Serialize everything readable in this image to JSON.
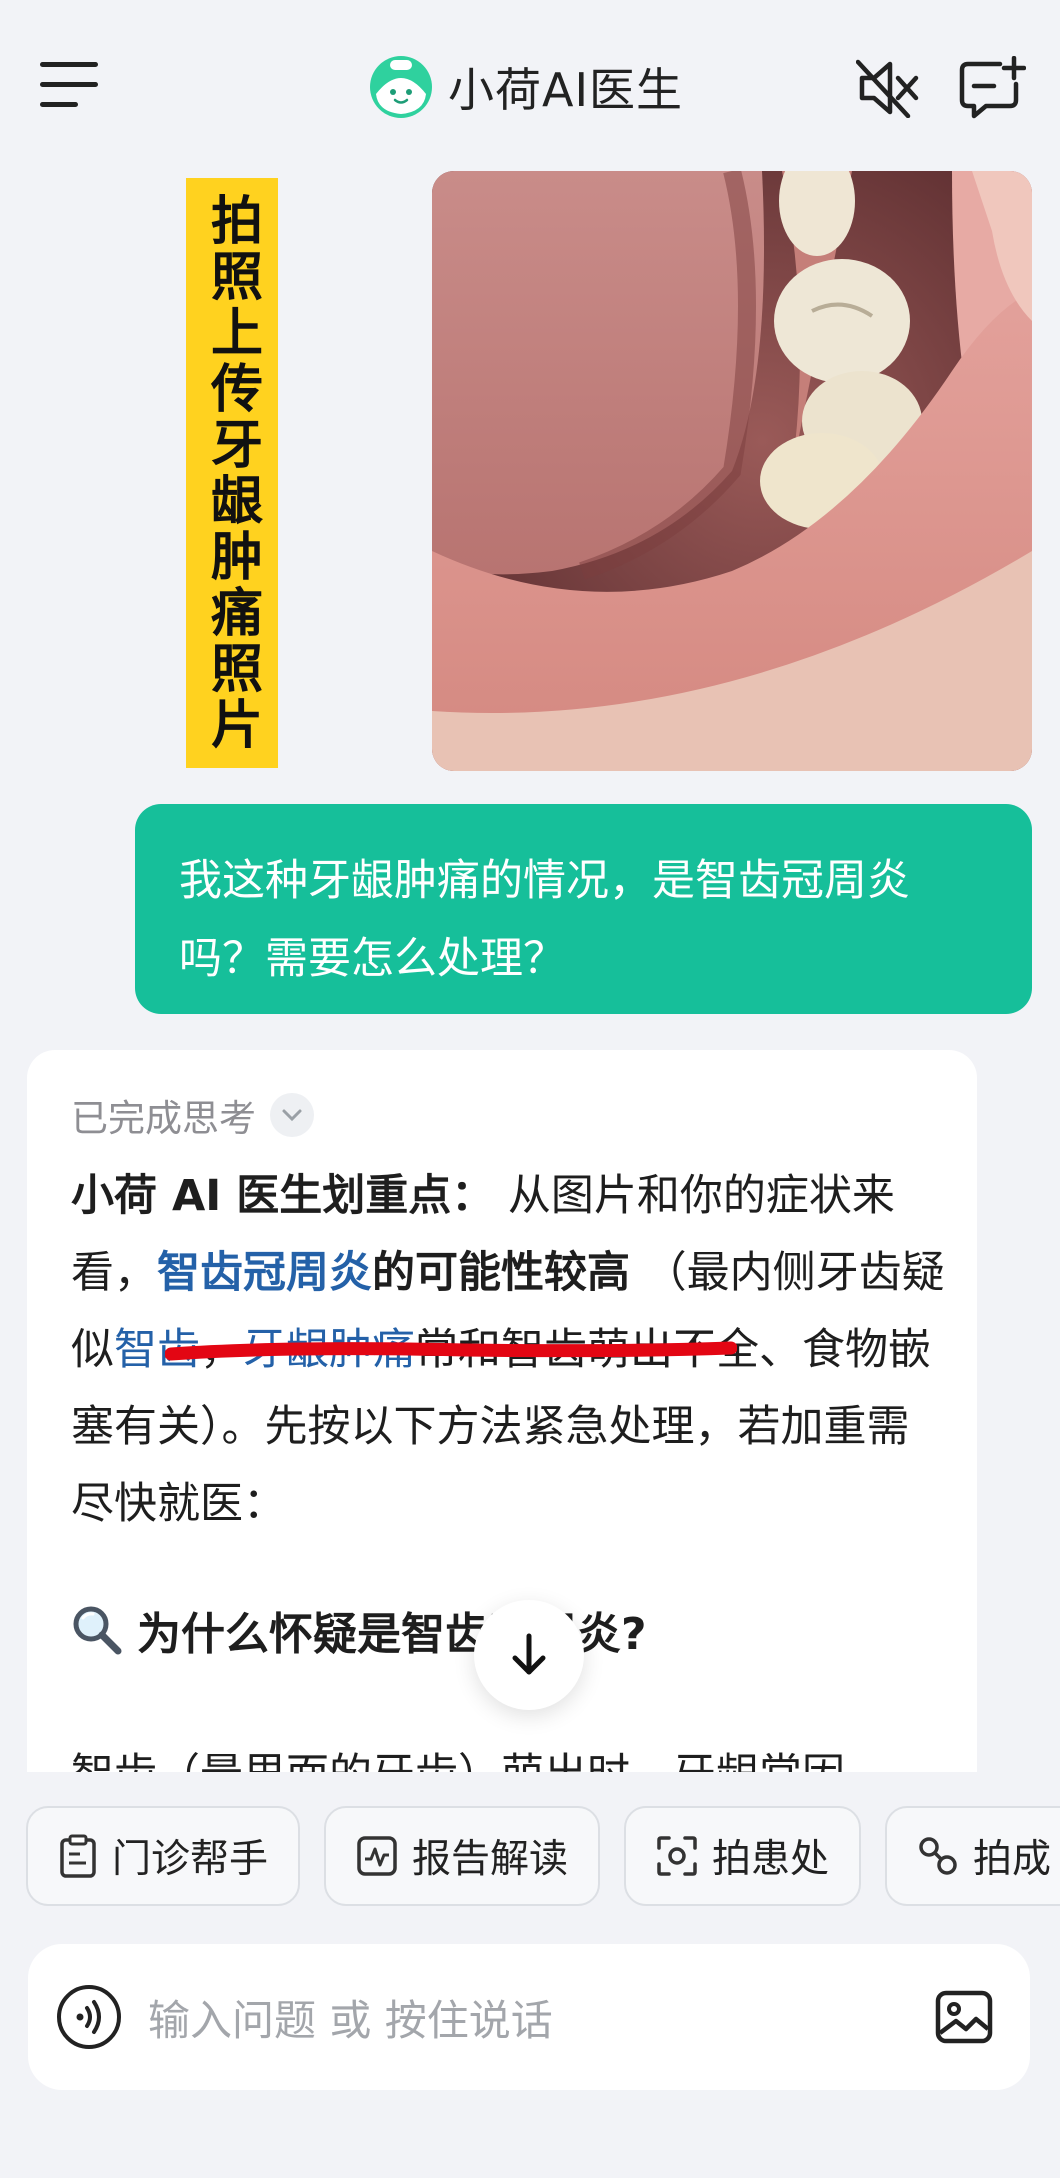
{
  "header": {
    "title": "小荷AI医生",
    "icons": [
      "menu-icon",
      "logo-icon",
      "mute-icon",
      "new-chat-icon"
    ]
  },
  "user_photo_banner": "拍照上传牙龈肿痛照片",
  "user_message": "我这种牙龈肿痛的情况，是智齿冠周炎吗？需要怎么处理？",
  "ai": {
    "thinking_label": "已完成思考",
    "answer": {
      "lead": "小荷 AI 医生划重点：",
      "t1": " 从图片和你的症状来看，",
      "diag_link": "智齿冠周炎",
      "diag_rest": "的可能性较高",
      "t2": " （最内侧牙齿疑似",
      "link2": "智齿",
      "t3": "，",
      "link3": "牙龈肿痛",
      "t4": "常和智齿萌出不全、食物嵌塞有关）。先按以下方法紧急处理，若加重需尽快就医："
    },
    "section_heading": "为什么怀疑是智齿冠周炎?",
    "cut_text": "智齿（最里面的牙齿）萌出时，牙龈常因"
  },
  "chips": [
    {
      "label": "门诊帮手",
      "icon": "clipboard-icon"
    },
    {
      "label": "报告解读",
      "icon": "report-icon"
    },
    {
      "label": "拍患处",
      "icon": "scan-icon"
    },
    {
      "label": "拍成",
      "icon": "pill-icon"
    }
  ],
  "input": {
    "placeholder": "输入问题 或 按住说话"
  },
  "colors": {
    "accent": "#16bf9a",
    "link": "#2461a8",
    "banner": "#ffd21f",
    "underline": "#e30613"
  }
}
